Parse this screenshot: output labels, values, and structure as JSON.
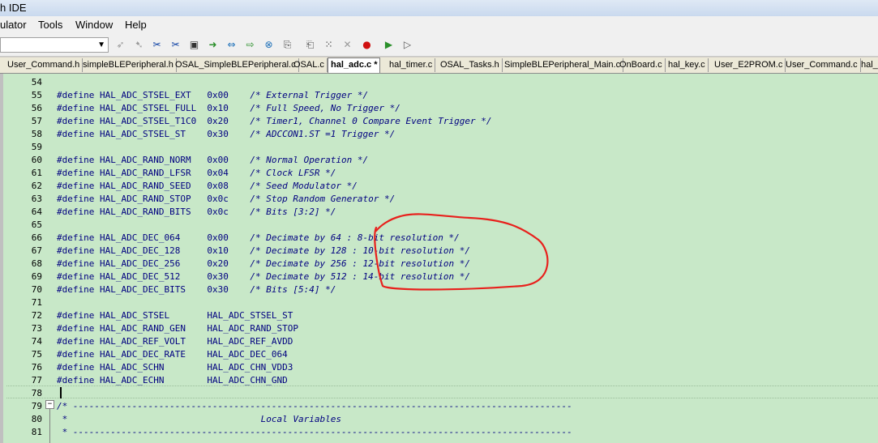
{
  "window": {
    "title": "h IDE"
  },
  "menu": [
    "ulator",
    "Tools",
    "Window",
    "Help"
  ],
  "toolbar": {
    "icons": [
      "run-to-cursor-icon",
      "step-icon",
      "breakpoint-icon",
      "toggle-icon",
      "memory-icon",
      "next-icon",
      "step-over-icon",
      "step-into-icon",
      "watch-icon",
      "reset-icon",
      "disassembly-icon",
      "registers-icon",
      "break-icon",
      "stop-icon",
      "go-icon",
      "run-icon"
    ]
  },
  "tabs": [
    {
      "label": "User_Command.h"
    },
    {
      "label": "simpleBLEPeripheral.h"
    },
    {
      "label": "OSAL_SimpleBLEPeripheral.c"
    },
    {
      "label": "OSAL.c"
    },
    {
      "label": "hal_adc.c *",
      "active": true
    },
    {
      "label": "hal_timer.c"
    },
    {
      "label": "OSAL_Tasks.h"
    },
    {
      "label": "SimpleBLEPeripheral_Main.c"
    },
    {
      "label": "OnBoard.c"
    },
    {
      "label": "hal_key.c"
    },
    {
      "label": "User_E2PROM.c"
    },
    {
      "label": "User_Command.c"
    },
    {
      "label": "hal_"
    }
  ],
  "code_lines": [
    {
      "n": "54",
      "text": ""
    },
    {
      "n": "55",
      "text": "#define HAL_ADC_STSEL_EXT   0x00    ",
      "comment": "/* External Trigger */"
    },
    {
      "n": "56",
      "text": "#define HAL_ADC_STSEL_FULL  0x10    ",
      "comment": "/* Full Speed, No Trigger */"
    },
    {
      "n": "57",
      "text": "#define HAL_ADC_STSEL_T1C0  0x20    ",
      "comment": "/* Timer1, Channel 0 Compare Event Trigger */"
    },
    {
      "n": "58",
      "text": "#define HAL_ADC_STSEL_ST    0x30    ",
      "comment": "/* ADCCON1.ST =1 Trigger */"
    },
    {
      "n": "59",
      "text": ""
    },
    {
      "n": "60",
      "text": "#define HAL_ADC_RAND_NORM   0x00    ",
      "comment": "/* Normal Operation */"
    },
    {
      "n": "61",
      "text": "#define HAL_ADC_RAND_LFSR   0x04    ",
      "comment": "/* Clock LFSR */"
    },
    {
      "n": "62",
      "text": "#define HAL_ADC_RAND_SEED   0x08    ",
      "comment": "/* Seed Modulator */"
    },
    {
      "n": "63",
      "text": "#define HAL_ADC_RAND_STOP   0x0c    ",
      "comment": "/* Stop Random Generator */"
    },
    {
      "n": "64",
      "text": "#define HAL_ADC_RAND_BITS   0x0c    ",
      "comment": "/* Bits [3:2] */"
    },
    {
      "n": "65",
      "text": ""
    },
    {
      "n": "66",
      "text": "#define HAL_ADC_DEC_064     0x00    ",
      "comment": "/* Decimate by 64 : 8-bit resolution */"
    },
    {
      "n": "67",
      "text": "#define HAL_ADC_DEC_128     0x10    ",
      "comment": "/* Decimate by 128 : 10-bit resolution */"
    },
    {
      "n": "68",
      "text": "#define HAL_ADC_DEC_256     0x20    ",
      "comment": "/* Decimate by 256 : 12-bit resolution */"
    },
    {
      "n": "69",
      "text": "#define HAL_ADC_DEC_512     0x30    ",
      "comment": "/* Decimate by 512 : 14-bit resolution */"
    },
    {
      "n": "70",
      "text": "#define HAL_ADC_DEC_BITS    0x30    ",
      "comment": "/* Bits [5:4] */"
    },
    {
      "n": "71",
      "text": ""
    },
    {
      "n": "72",
      "text": "#define HAL_ADC_STSEL       HAL_ADC_STSEL_ST"
    },
    {
      "n": "73",
      "text": "#define HAL_ADC_RAND_GEN    HAL_ADC_RAND_STOP"
    },
    {
      "n": "74",
      "text": "#define HAL_ADC_REF_VOLT    HAL_ADC_REF_AVDD"
    },
    {
      "n": "75",
      "text": "#define HAL_ADC_DEC_RATE    HAL_ADC_DEC_064"
    },
    {
      "n": "76",
      "text": "#define HAL_ADC_SCHN        HAL_ADC_CHN_VDD3"
    },
    {
      "n": "77",
      "text": "#define HAL_ADC_ECHN        HAL_ADC_CHN_GND"
    },
    {
      "n": "78",
      "text": ""
    },
    {
      "n": "79",
      "text": "",
      "comment": "/* ---------------------------------------------------------------------------------------------"
    },
    {
      "n": "80",
      "text": "",
      "comment": " *                                    Local Variables"
    },
    {
      "n": "81",
      "text": "",
      "comment": " * ---------------------------------------------------------------------------------------------"
    }
  ],
  "colors": {
    "editor_bg": "#c8e8c8",
    "code": "#000080",
    "annotation": "#e8201c"
  }
}
